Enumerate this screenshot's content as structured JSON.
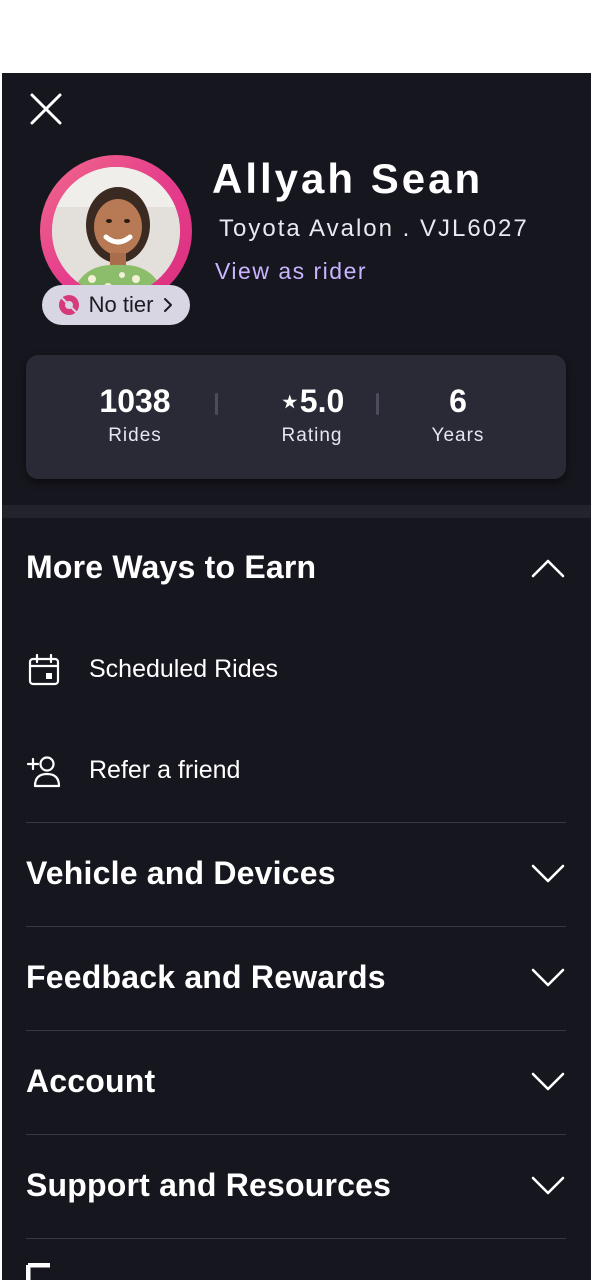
{
  "profile": {
    "name": "Allyah Sean",
    "vehicle": "Toyota Avalon . VJL6027",
    "view_as_rider": "View as rider",
    "tier_label": "No tier"
  },
  "stats": {
    "rides": {
      "value": "1038",
      "label": "Rides"
    },
    "rating": {
      "value": "⋆5.0",
      "label": "Rating"
    },
    "years": {
      "value": "6",
      "label": "Years"
    }
  },
  "sections": {
    "more_ways": {
      "title": "More Ways to Earn",
      "expanded": true,
      "items": [
        {
          "label": "Scheduled Rides",
          "icon": "calendar-icon"
        },
        {
          "label": "Refer a friend",
          "icon": "add-person-icon"
        }
      ]
    },
    "vehicle_devices": {
      "title": "Vehicle and Devices",
      "expanded": false
    },
    "feedback_rewards": {
      "title": "Feedback and Rewards",
      "expanded": false
    },
    "account": {
      "title": "Account",
      "expanded": false
    },
    "support": {
      "title": "Support and Resources",
      "expanded": false
    }
  },
  "colors": {
    "background": "#16161e",
    "card": "#2a2a36",
    "accent_link": "#c9b5ff",
    "avatar_ring": "#e63d8c",
    "tier_pill": "#d8d6e2"
  }
}
